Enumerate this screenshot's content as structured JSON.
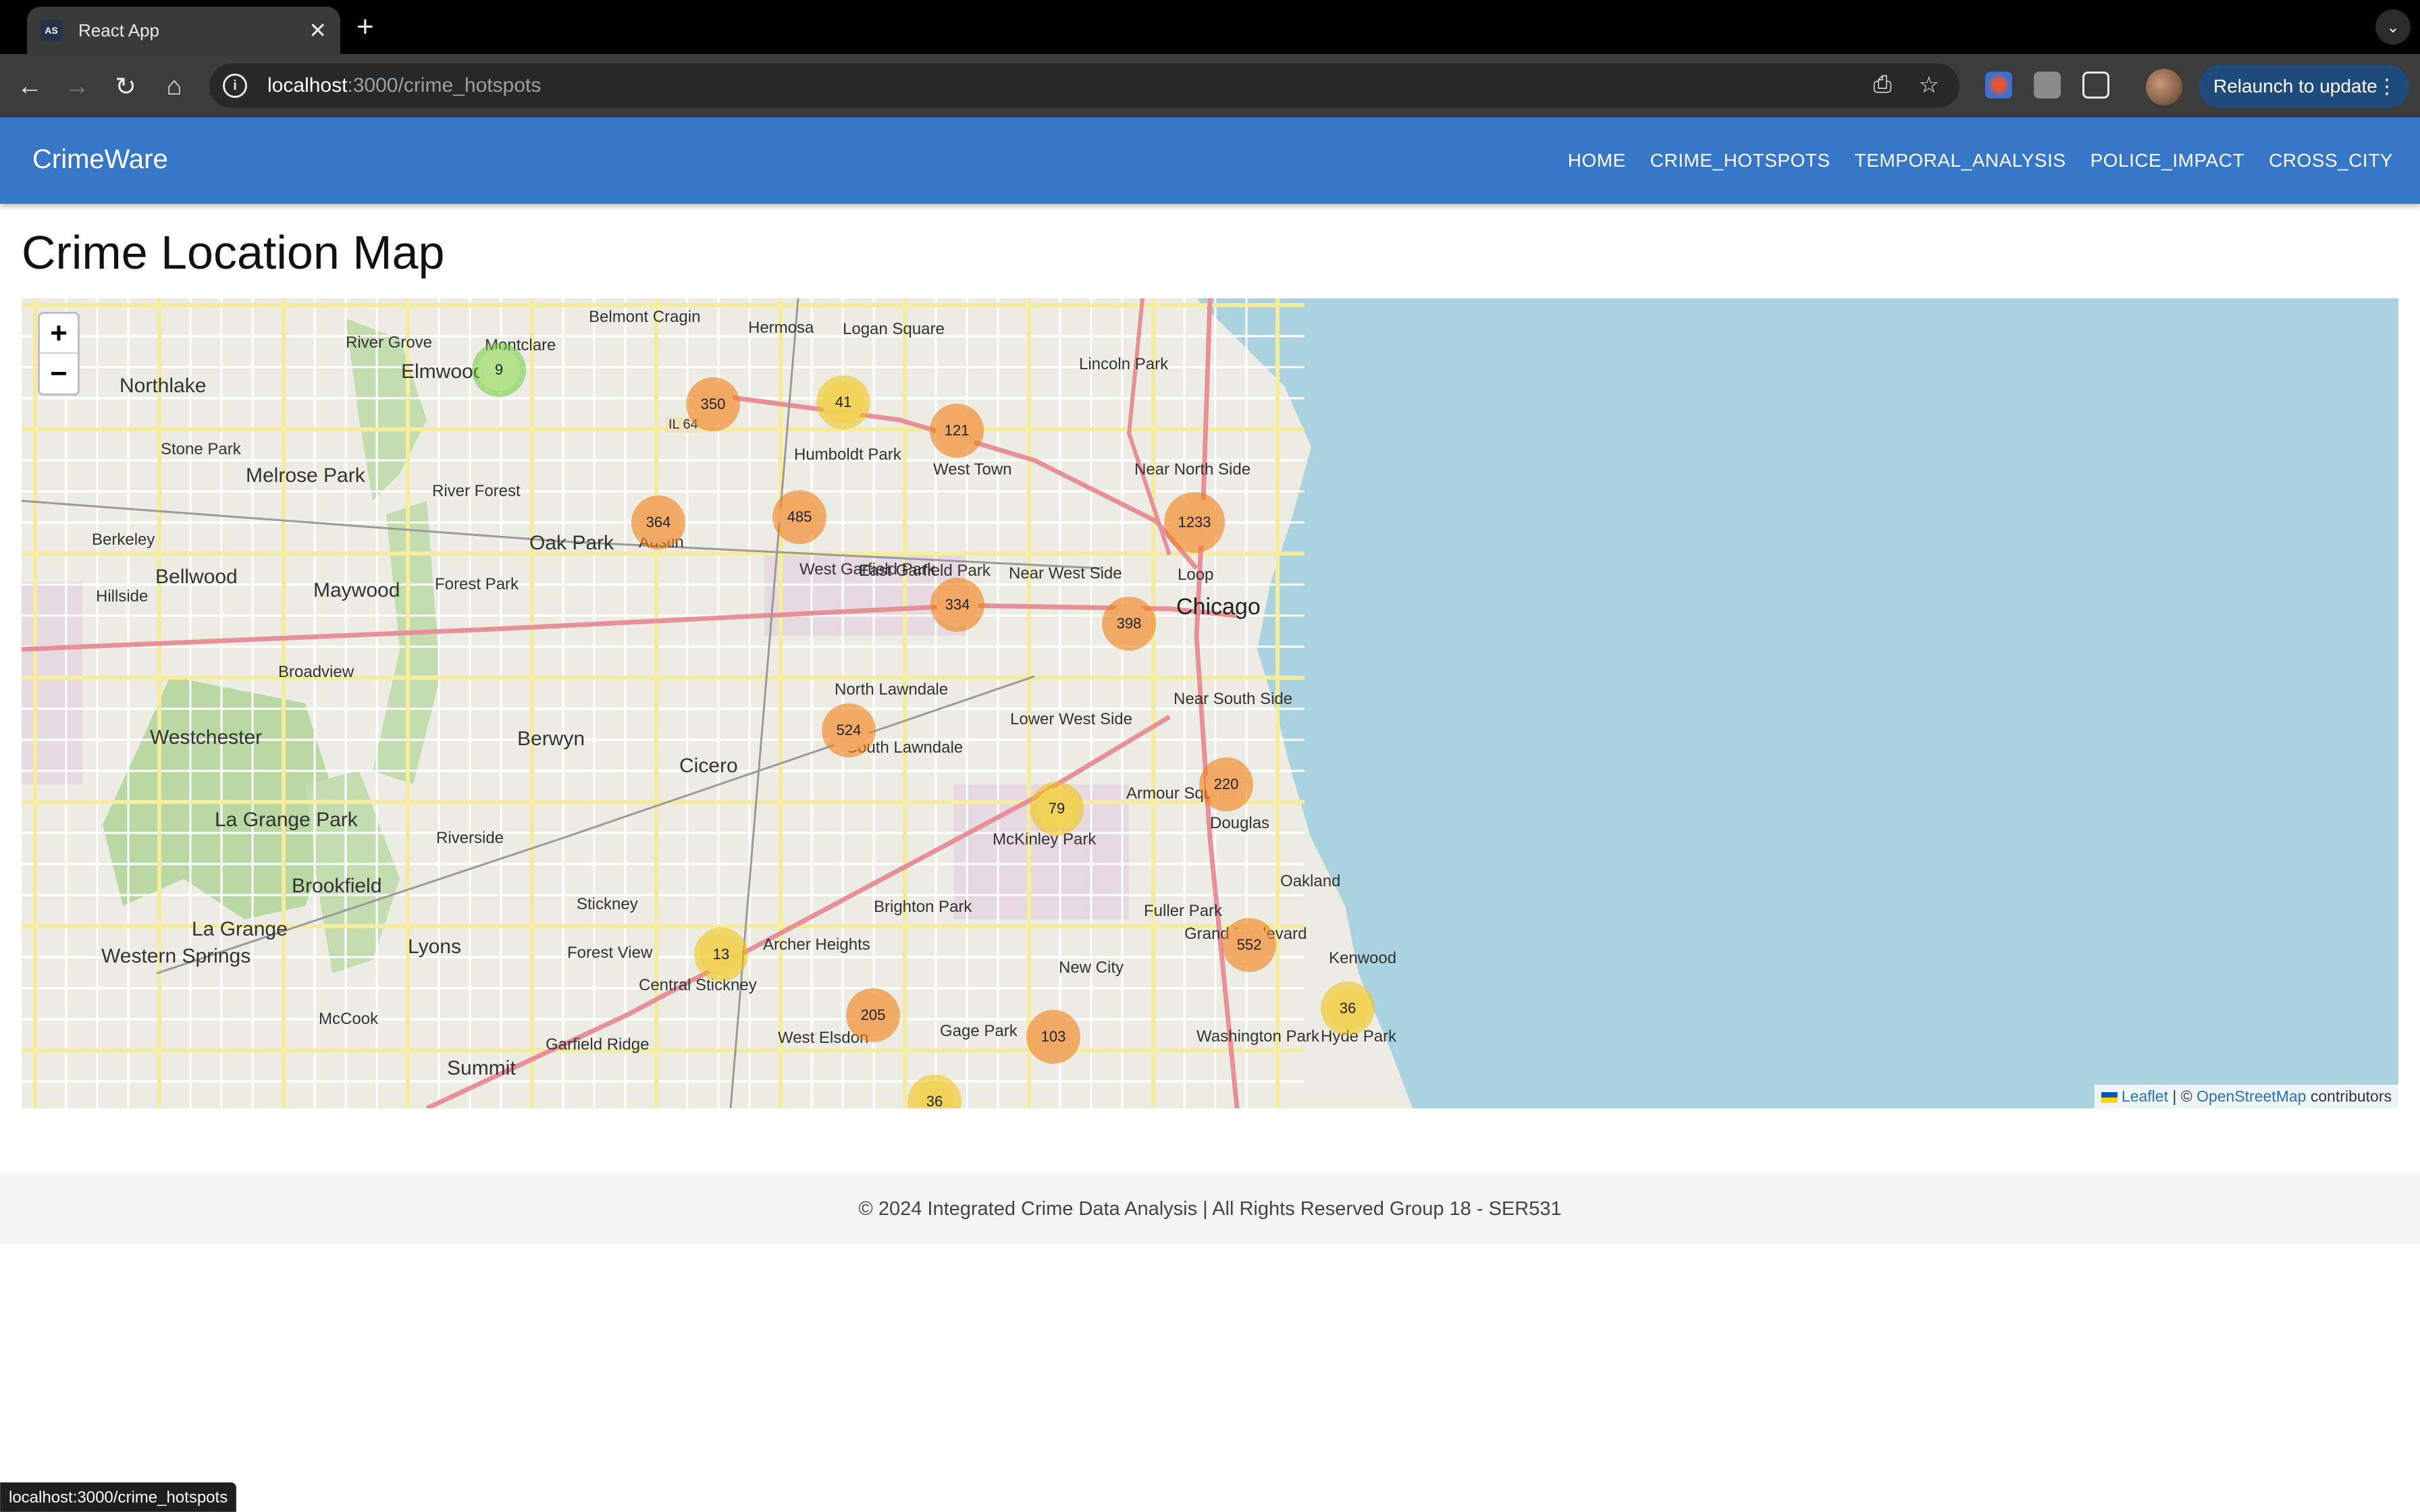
{
  "browser": {
    "tab_title": "React App",
    "tab_favicon": "AS",
    "url_host": "localhost",
    "url_path": ":3000/crime_hotspots",
    "relaunch_label": "Relaunch to update",
    "status_url": "localhost:3000/crime_hotspots"
  },
  "app": {
    "brand": "CrimeWare",
    "nav": [
      "HOME",
      "CRIME_HOTSPOTS",
      "TEMPORAL_ANALYSIS",
      "POLICE_IMPACT",
      "CROSS_CITY"
    ],
    "page_title": "Crime Location Map",
    "footer": "© 2024 Integrated Crime Data Analysis | All Rights Reserved Group 18 - SER531"
  },
  "map": {
    "zoom_in": "+",
    "zoom_out": "−",
    "attribution": {
      "leaflet": "Leaflet",
      "sep": " | © ",
      "osm": "OpenStreetMap",
      "suffix": " contributors"
    },
    "clusters": [
      {
        "count": "9",
        "color": "green"
      },
      {
        "count": "350",
        "color": "orange"
      },
      {
        "count": "41",
        "color": "yellow"
      },
      {
        "count": "121",
        "color": "orange"
      },
      {
        "count": "1233",
        "color": "orange"
      },
      {
        "count": "485",
        "color": "orange"
      },
      {
        "count": "364",
        "color": "orange"
      },
      {
        "count": "334",
        "color": "orange"
      },
      {
        "count": "398",
        "color": "orange"
      },
      {
        "count": "524",
        "color": "orange"
      },
      {
        "count": "220",
        "color": "orange"
      },
      {
        "count": "79",
        "color": "yellow"
      },
      {
        "count": "552",
        "color": "orange"
      },
      {
        "count": "13",
        "color": "yellow"
      },
      {
        "count": "36",
        "color": "yellow"
      },
      {
        "count": "205",
        "color": "orange"
      },
      {
        "count": "103",
        "color": "orange"
      },
      {
        "count": "36",
        "color": "yellow"
      }
    ],
    "labels": [
      "Northlake",
      "Elmwood",
      "River Grove",
      "Montclare",
      "Belmont Cragin",
      "Hermosa",
      "Logan Square",
      "Lincoln Park",
      "Humboldt Park",
      "West Town",
      "Near North Side",
      "Melrose Park",
      "Stone Park",
      "River Forest",
      "Oak Park",
      "Austin",
      "West Garfield Park",
      "East Garfield Park",
      "Near West Side",
      "Loop",
      "Chicago",
      "Berkeley",
      "Bellwood",
      "Maywood",
      "Forest Park",
      "Hillside",
      "Broadview",
      "North Lawndale",
      "Lower West Side",
      "Near South Side",
      "Westchester",
      "Berwyn",
      "Cicero",
      "South Lawndale",
      "Armour Square",
      "Douglas",
      "La Grange Park",
      "Riverside",
      "McKinley Park",
      "Brookfield",
      "Stickney",
      "Brighton Park",
      "Fuller Park",
      "Oakland",
      "La Grange",
      "Lyons",
      "Forest View",
      "Archer Heights",
      "Grand Boulevard",
      "Kenwood",
      "Western Springs",
      "Central Stickney",
      "New City",
      "McCook",
      "Garfield Ridge",
      "West Elsdon",
      "Gage Park",
      "Washington Park",
      "Hyde Park",
      "Summit",
      "IL 64"
    ]
  },
  "colors": {
    "appbar": "#3777c8",
    "cluster_orange": "#f1a964",
    "cluster_yellow": "#f0d24a",
    "cluster_green": "#a7d264",
    "water": "#aad3df"
  }
}
